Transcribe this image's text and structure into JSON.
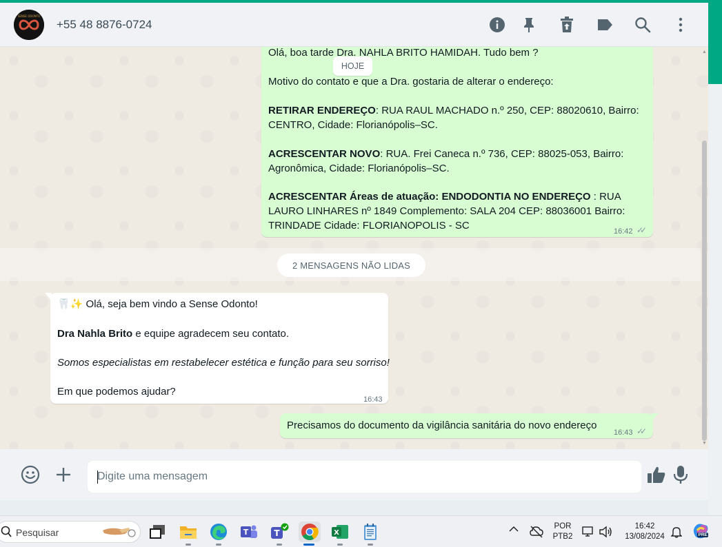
{
  "header": {
    "contact": "+55 48 8876-0724",
    "icons": [
      "info-icon",
      "pin-icon",
      "delete-icon",
      "label-icon",
      "search-icon",
      "menu-icon"
    ]
  },
  "chat": {
    "date_separator": "HOJE",
    "unread_label": "2 MENSAGENS NÃO LIDAS",
    "messages": [
      {
        "direction": "out",
        "greeting": "Olá, boa tarde Dra. NAHLA BRITO HAMIDAH. Tudo bem ?",
        "reason": "Motivo do contato e que a Dra. gostaria de alterar o endereço:",
        "remove_label": "RETIRAR ENDEREÇO",
        "remove_line1": ": RUA RAUL MACHADO n.º 250, CEP: 88020610, Bairro:",
        "remove_line2": "CENTRO, Cidade: Florianópolis–SC.",
        "add_label": "ACRESCENTAR NOVO",
        "add_line1": ": RUA. Frei Caneca n.º 736, CEP: 88025-053, Bairro:",
        "add_line2": "Agronômica, Cidade: Florianópolis–SC.",
        "area_label": "ACRESCENTAR Áreas de atuação: ENDODONTIA NO ENDEREÇO",
        "area_line1": " : RUA",
        "area_line2": "LAURO LINHARES nº 1849 Complemento: SALA 204 CEP: 88036001 Bairro:",
        "area_line3": "TRINDADE Cidade: FLORIANOPOLIS - SC",
        "time": "16:42"
      },
      {
        "direction": "in",
        "line1": "🦷✨ Olá, seja bem vindo a Sense Odonto!",
        "line2_bold": "Dra Nahla Brito",
        "line2_rest": " e equipe agradecem seu contato.",
        "line3": "Somos especialistas em restabelecer estética e função para seu sorriso!",
        "line4": "Em que podemos ajudar?",
        "time": "16:43"
      },
      {
        "direction": "out",
        "text": "Precisamos do documento da vigilância sanitária do novo endereço",
        "time": "16:43"
      }
    ]
  },
  "composer": {
    "placeholder": "Digite uma mensagem"
  },
  "taskbar": {
    "search_label": "Pesquisar",
    "lang_line1": "POR",
    "lang_line2": "PTB2",
    "time": "16:42",
    "date": "13/08/2024",
    "copilot_badge": "PRE"
  },
  "colors": {
    "accent": "#00a884",
    "outgoing_bubble": "#d9fdd3",
    "incoming_bubble": "#ffffff",
    "chat_bg": "#efeae2"
  }
}
